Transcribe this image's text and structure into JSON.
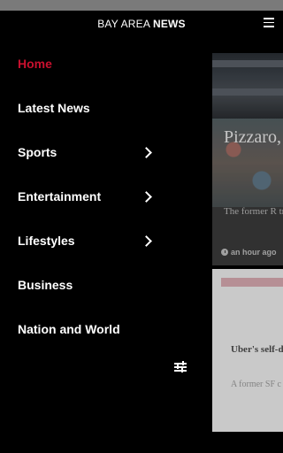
{
  "app": {
    "brand_part1": "BAY AREA ",
    "brand_part2": "NEWS",
    "accent_color": "#c8102e",
    "menu_icon": "hamburger-icon"
  },
  "drawer": {
    "items": [
      {
        "label": "Home",
        "active": true,
        "has_submenu": false
      },
      {
        "label": "Latest News",
        "active": false,
        "has_submenu": false
      },
      {
        "label": "Sports",
        "active": false,
        "has_submenu": true
      },
      {
        "label": "Entertainment",
        "active": false,
        "has_submenu": true
      },
      {
        "label": "Lifestyles",
        "active": false,
        "has_submenu": true
      },
      {
        "label": "Business",
        "active": false,
        "has_submenu": false
      },
      {
        "label": "Nation and World",
        "active": false,
        "has_submenu": false
      }
    ],
    "settings_icon": "sliders-icon"
  },
  "feed": {
    "story1": {
      "headline": "Pizzaro, becoming downto",
      "summary": "The former R transformed i a performanc",
      "time": "an hour ago"
    },
    "story2": {
      "headline": "Uber's self-d Francisco ca",
      "summary": "A former SF c self-driving ca Francisco"
    }
  }
}
